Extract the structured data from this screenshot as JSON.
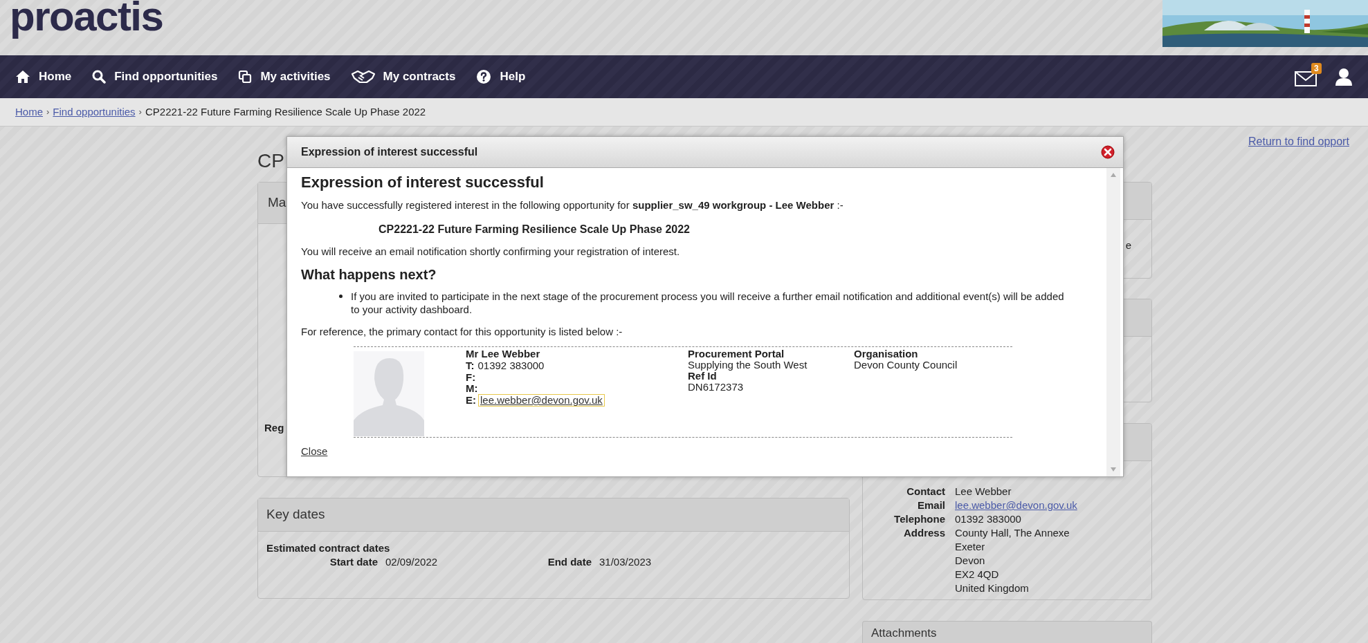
{
  "header": {
    "logo": "proactis"
  },
  "nav": {
    "items": [
      {
        "label": "Home",
        "kind": "home"
      },
      {
        "label": "Find opportunities",
        "kind": "search"
      },
      {
        "label": "My activities",
        "kind": "activities"
      },
      {
        "label": "My contracts",
        "kind": "contracts"
      },
      {
        "label": "Help",
        "kind": "help"
      }
    ],
    "message_count": "3"
  },
  "breadcrumb_separator": "›",
  "breadcrumb": [
    {
      "label": "Home",
      "link": true
    },
    {
      "label": "Find opportunities",
      "link": true
    },
    {
      "label": "CP2221-22 Future Farming Resilience Scale Up Phase 2022",
      "link": false
    }
  ],
  "return_link": "Return to find opport",
  "page": {
    "title": "CP",
    "main_panel": {
      "title": "Ma",
      "row_label": "Reg"
    },
    "side_panel_text": "e",
    "key_dates": {
      "title": "Key dates",
      "subtitle": "Estimated contract dates",
      "start_label": "Start date",
      "start_value": "02/09/2022",
      "end_label": "End date",
      "end_value": "31/03/2023"
    },
    "contact_rows": [
      {
        "label": "Contact",
        "lines": [
          "Lee Webber"
        ],
        "link": false
      },
      {
        "label": "Email",
        "lines": [
          "lee.webber@devon.gov.uk"
        ],
        "link": true
      },
      {
        "label": "Telephone",
        "lines": [
          "01392 383000"
        ],
        "link": false
      },
      {
        "label": "Address",
        "lines": [
          "County Hall, The Annexe",
          "Exeter",
          "Devon",
          "EX2 4QD",
          "United Kingdom"
        ],
        "link": false
      }
    ],
    "attachments_title": "Attachments"
  },
  "modal": {
    "title": "Expression of interest successful",
    "heading": "Expression of interest successful",
    "intro": "You have successfully registered interest in the following opportunity for **supplier_sw_49 workgroup - Lee Webber** :-",
    "opportunity": "CP2221-22 Future Farming Resilience Scale Up Phase 2022",
    "notice": "You will receive an email notification shortly confirming your registration of interest.",
    "next_heading": "What happens next?",
    "bullets": [
      "If you are invited to participate in the next stage of the procurement process you will receive a further email notification and additional event(s) will be added to your activity dashboard."
    ],
    "reference": "For reference, the primary contact for this opportunity is listed below :-",
    "contact": {
      "name": "Mr Lee Webber",
      "lines": [
        {
          "label": "T:",
          "value": "01392 383000",
          "kind": "text",
          "focused": false
        },
        {
          "label": "F:"
        },
        {
          "label": "M:"
        },
        {
          "label": "E:",
          "value": "lee.webber@devon.gov.uk",
          "kind": "email",
          "focused": true
        }
      ],
      "columns": [
        {
          "label": "Procurement Portal",
          "value": "Supplying the South West"
        },
        {
          "label": "Ref Id",
          "value": "DN6172373"
        }
      ],
      "organisation": {
        "label": "Organisation",
        "value": "Devon County Council"
      }
    },
    "close": "Close"
  }
}
